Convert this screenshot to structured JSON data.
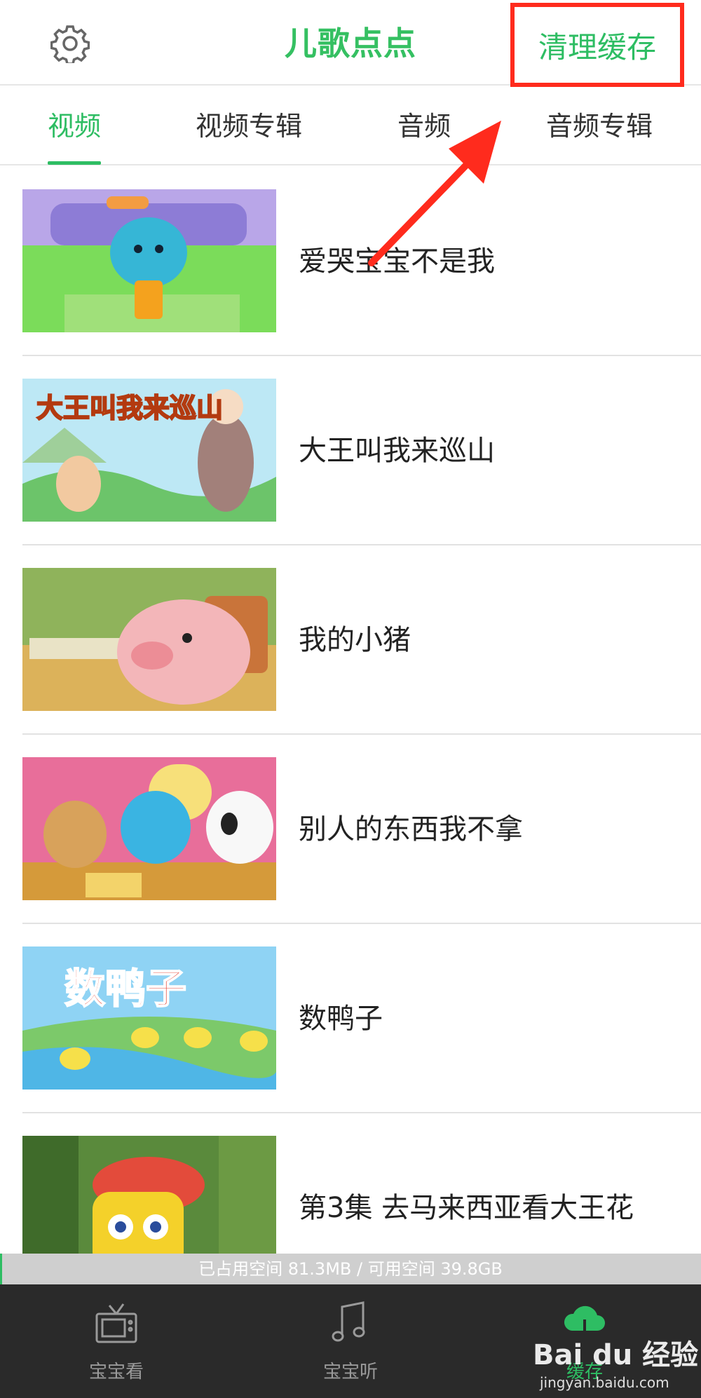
{
  "header": {
    "logo_text": "儿歌点点",
    "clear_cache_label": "清理缓存",
    "icons": {
      "settings": "gear-icon"
    }
  },
  "tabs": [
    {
      "label": "视频",
      "active": true
    },
    {
      "label": "视频专辑",
      "active": false
    },
    {
      "label": "音频",
      "active": false
    },
    {
      "label": "音频专辑",
      "active": false
    }
  ],
  "videos": [
    {
      "title": "爱哭宝宝不是我",
      "thumbnail": "crying-blue-dinosaur"
    },
    {
      "title": "大王叫我来巡山",
      "thumbnail": "da-wang-jiao-wo-lai-xun-shan",
      "thumbnail_text": "大王叫我来巡山"
    },
    {
      "title": "我的小猪",
      "thumbnail": "pink-piglet"
    },
    {
      "title": "别人的东西我不拿",
      "thumbnail": "mouse-dinosaur-panda"
    },
    {
      "title": "数鸭子",
      "thumbnail": "ducks-on-river",
      "thumbnail_text": "数鸭子"
    },
    {
      "title": "第3集 去马来西亚看大王花",
      "thumbnail": "robot-plane"
    }
  ],
  "storage": {
    "text": "已占用空间 81.3MB / 可用空间 39.8GB",
    "used_fraction": 0.002
  },
  "bottom_nav": [
    {
      "label": "宝宝看",
      "icon": "tv-icon",
      "active": false
    },
    {
      "label": "宝宝听",
      "icon": "music-note-icon",
      "active": false
    },
    {
      "label": "缓存",
      "icon": "cloud-download-icon",
      "active": true
    }
  ],
  "watermark": {
    "main": "Bai du 经验",
    "sub": "jingyan.baidu.com"
  },
  "colors": {
    "accent": "#2ebd63",
    "annotation_red": "#ff2b1d",
    "nav_background": "#2a2a2a"
  }
}
